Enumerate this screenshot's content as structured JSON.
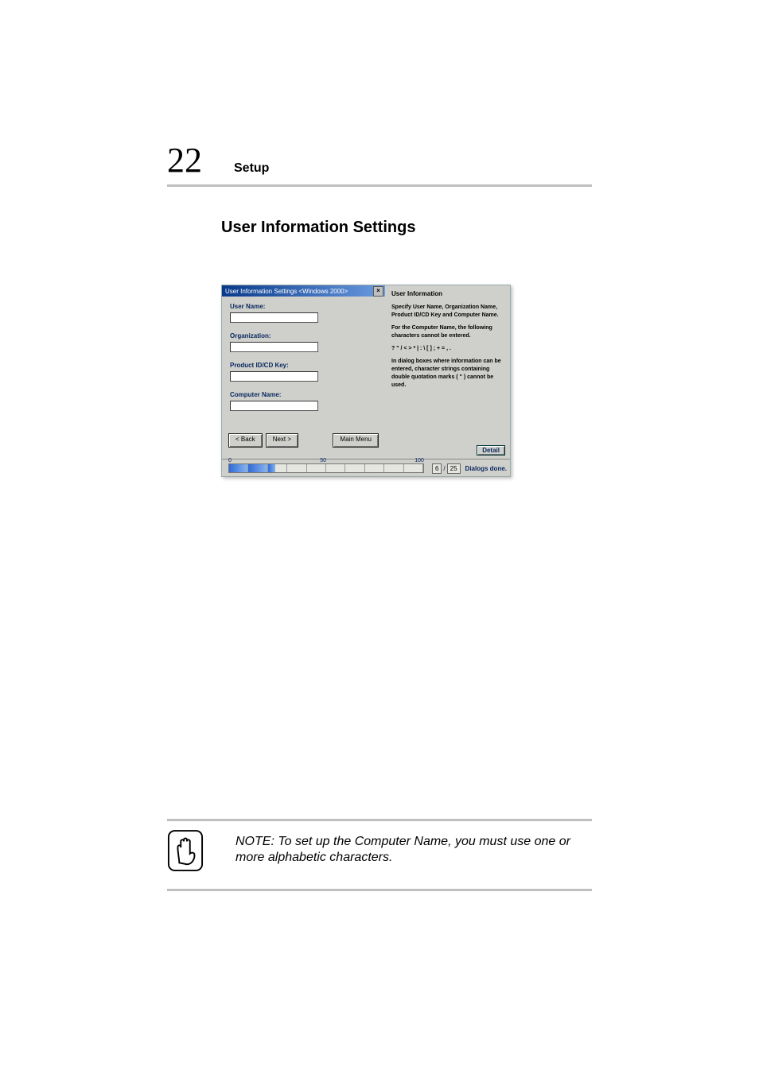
{
  "page_number": "22",
  "chapter": "Setup",
  "section_title": "User Information Settings",
  "dialog": {
    "titlebar": "User Information Settings <Windows 2000>",
    "close_glyph": "×",
    "fields": {
      "user_name_label": "User Name:",
      "organization_label": "Organization:",
      "product_key_label": "Product ID/CD Key:",
      "computer_name_label": "Computer Name:"
    },
    "buttons": {
      "back": "< Back",
      "next": "Next >",
      "main_menu": "Main Menu"
    }
  },
  "help": {
    "title": "User Information",
    "p1": "Specify User Name, Organization Name, Product ID/CD Key and Computer Name.",
    "p2": "For the Computer Name, the following characters cannot be entered.",
    "p3": "? \" / < > * | : \\ [ ] ; + = , .",
    "p4": "In dialog boxes where information can be entered, character strings containing double quotation marks ( \" ) cannot be used.",
    "detail_btn": "Detail"
  },
  "footer": {
    "scale_min": "0",
    "scale_mid": "50",
    "scale_max": "100",
    "current": "6",
    "sep": "/",
    "total": "25",
    "status": "Dialogs done."
  },
  "note": {
    "text": "NOTE: To set up the Computer Name, you must use one or more alphabetic characters."
  }
}
